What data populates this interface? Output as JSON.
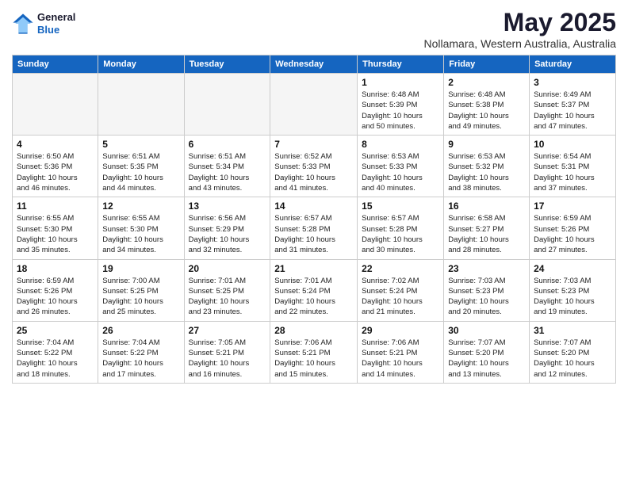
{
  "header": {
    "logo_general": "General",
    "logo_blue": "Blue",
    "month": "May 2025",
    "location": "Nollamara, Western Australia, Australia"
  },
  "weekdays": [
    "Sunday",
    "Monday",
    "Tuesday",
    "Wednesday",
    "Thursday",
    "Friday",
    "Saturday"
  ],
  "weeks": [
    [
      {
        "day": "",
        "info": ""
      },
      {
        "day": "",
        "info": ""
      },
      {
        "day": "",
        "info": ""
      },
      {
        "day": "",
        "info": ""
      },
      {
        "day": "1",
        "info": "Sunrise: 6:48 AM\nSunset: 5:39 PM\nDaylight: 10 hours\nand 50 minutes."
      },
      {
        "day": "2",
        "info": "Sunrise: 6:48 AM\nSunset: 5:38 PM\nDaylight: 10 hours\nand 49 minutes."
      },
      {
        "day": "3",
        "info": "Sunrise: 6:49 AM\nSunset: 5:37 PM\nDaylight: 10 hours\nand 47 minutes."
      }
    ],
    [
      {
        "day": "4",
        "info": "Sunrise: 6:50 AM\nSunset: 5:36 PM\nDaylight: 10 hours\nand 46 minutes."
      },
      {
        "day": "5",
        "info": "Sunrise: 6:51 AM\nSunset: 5:35 PM\nDaylight: 10 hours\nand 44 minutes."
      },
      {
        "day": "6",
        "info": "Sunrise: 6:51 AM\nSunset: 5:34 PM\nDaylight: 10 hours\nand 43 minutes."
      },
      {
        "day": "7",
        "info": "Sunrise: 6:52 AM\nSunset: 5:33 PM\nDaylight: 10 hours\nand 41 minutes."
      },
      {
        "day": "8",
        "info": "Sunrise: 6:53 AM\nSunset: 5:33 PM\nDaylight: 10 hours\nand 40 minutes."
      },
      {
        "day": "9",
        "info": "Sunrise: 6:53 AM\nSunset: 5:32 PM\nDaylight: 10 hours\nand 38 minutes."
      },
      {
        "day": "10",
        "info": "Sunrise: 6:54 AM\nSunset: 5:31 PM\nDaylight: 10 hours\nand 37 minutes."
      }
    ],
    [
      {
        "day": "11",
        "info": "Sunrise: 6:55 AM\nSunset: 5:30 PM\nDaylight: 10 hours\nand 35 minutes."
      },
      {
        "day": "12",
        "info": "Sunrise: 6:55 AM\nSunset: 5:30 PM\nDaylight: 10 hours\nand 34 minutes."
      },
      {
        "day": "13",
        "info": "Sunrise: 6:56 AM\nSunset: 5:29 PM\nDaylight: 10 hours\nand 32 minutes."
      },
      {
        "day": "14",
        "info": "Sunrise: 6:57 AM\nSunset: 5:28 PM\nDaylight: 10 hours\nand 31 minutes."
      },
      {
        "day": "15",
        "info": "Sunrise: 6:57 AM\nSunset: 5:28 PM\nDaylight: 10 hours\nand 30 minutes."
      },
      {
        "day": "16",
        "info": "Sunrise: 6:58 AM\nSunset: 5:27 PM\nDaylight: 10 hours\nand 28 minutes."
      },
      {
        "day": "17",
        "info": "Sunrise: 6:59 AM\nSunset: 5:26 PM\nDaylight: 10 hours\nand 27 minutes."
      }
    ],
    [
      {
        "day": "18",
        "info": "Sunrise: 6:59 AM\nSunset: 5:26 PM\nDaylight: 10 hours\nand 26 minutes."
      },
      {
        "day": "19",
        "info": "Sunrise: 7:00 AM\nSunset: 5:25 PM\nDaylight: 10 hours\nand 25 minutes."
      },
      {
        "day": "20",
        "info": "Sunrise: 7:01 AM\nSunset: 5:25 PM\nDaylight: 10 hours\nand 23 minutes."
      },
      {
        "day": "21",
        "info": "Sunrise: 7:01 AM\nSunset: 5:24 PM\nDaylight: 10 hours\nand 22 minutes."
      },
      {
        "day": "22",
        "info": "Sunrise: 7:02 AM\nSunset: 5:24 PM\nDaylight: 10 hours\nand 21 minutes."
      },
      {
        "day": "23",
        "info": "Sunrise: 7:03 AM\nSunset: 5:23 PM\nDaylight: 10 hours\nand 20 minutes."
      },
      {
        "day": "24",
        "info": "Sunrise: 7:03 AM\nSunset: 5:23 PM\nDaylight: 10 hours\nand 19 minutes."
      }
    ],
    [
      {
        "day": "25",
        "info": "Sunrise: 7:04 AM\nSunset: 5:22 PM\nDaylight: 10 hours\nand 18 minutes."
      },
      {
        "day": "26",
        "info": "Sunrise: 7:04 AM\nSunset: 5:22 PM\nDaylight: 10 hours\nand 17 minutes."
      },
      {
        "day": "27",
        "info": "Sunrise: 7:05 AM\nSunset: 5:21 PM\nDaylight: 10 hours\nand 16 minutes."
      },
      {
        "day": "28",
        "info": "Sunrise: 7:06 AM\nSunset: 5:21 PM\nDaylight: 10 hours\nand 15 minutes."
      },
      {
        "day": "29",
        "info": "Sunrise: 7:06 AM\nSunset: 5:21 PM\nDaylight: 10 hours\nand 14 minutes."
      },
      {
        "day": "30",
        "info": "Sunrise: 7:07 AM\nSunset: 5:20 PM\nDaylight: 10 hours\nand 13 minutes."
      },
      {
        "day": "31",
        "info": "Sunrise: 7:07 AM\nSunset: 5:20 PM\nDaylight: 10 hours\nand 12 minutes."
      }
    ]
  ]
}
